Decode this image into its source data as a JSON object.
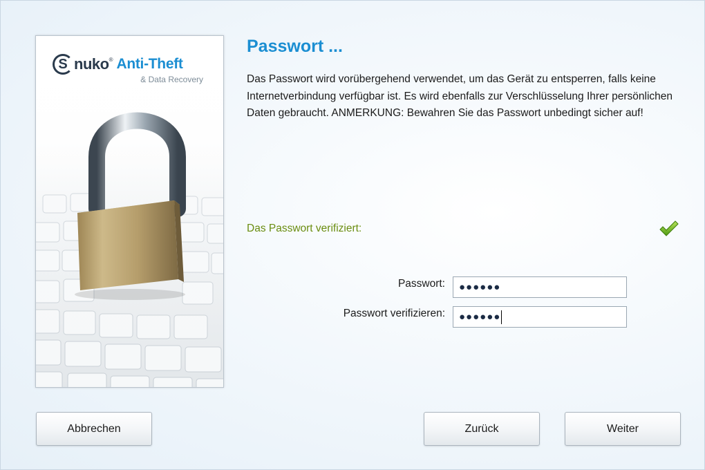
{
  "brand": {
    "logo_letter": "S",
    "logo_name": "nuko",
    "logo_reg": "®",
    "logo_product": "Anti-Theft",
    "logo_tagline": "& Data Recovery"
  },
  "page": {
    "title": "Passwort ...",
    "description": "Das Passwort wird vorübergehend verwendet, um das Gerät zu entsperren, falls keine Internetverbindung verfügbar ist. Es wird ebenfalls zur Verschlüsselung Ihrer persönlichen Daten gebraucht. ANMERKUNG: Bewahren Sie das Passwort unbedingt sicher auf!",
    "verify_status": "Das Passwort verifiziert:",
    "status_icon": "checkmark-icon",
    "status_color": "#6a8d10"
  },
  "form": {
    "password_label": "Passwort:",
    "password_value": "●●●●●●",
    "verify_label": "Passwort verifizieren:",
    "verify_value": "●●●●●●"
  },
  "buttons": {
    "cancel": "Abbrechen",
    "back": "Zurück",
    "next": "Weiter"
  },
  "colors": {
    "accent": "#1b8ed2",
    "success": "#6a8d10"
  }
}
